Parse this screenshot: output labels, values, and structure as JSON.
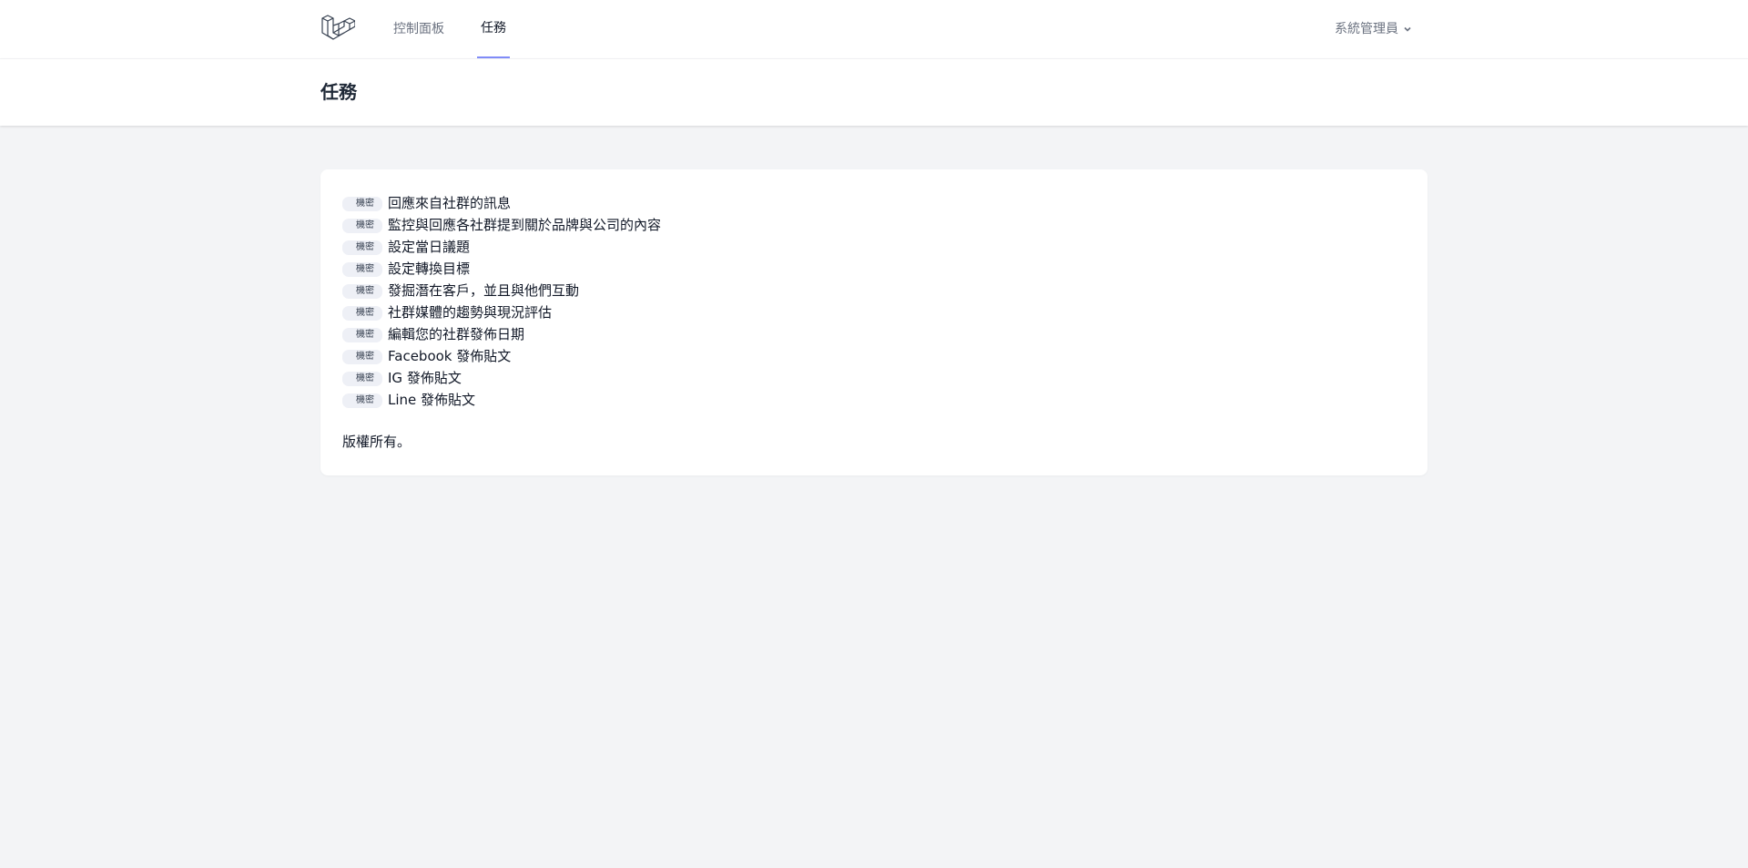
{
  "nav": {
    "links": [
      {
        "label": "控制面板"
      },
      {
        "label": "任務"
      }
    ],
    "user_name": "系統管理員"
  },
  "header": {
    "title": "任務"
  },
  "tasks": [
    {
      "badge": "機密",
      "title": "回應來自社群的訊息"
    },
    {
      "badge": "機密",
      "title": "監控與回應各社群提到關於品牌與公司的內容"
    },
    {
      "badge": "機密",
      "title": "設定當日議題"
    },
    {
      "badge": "機密",
      "title": "設定轉換目標"
    },
    {
      "badge": "機密",
      "title": "發掘潛在客戶，並且與他們互動"
    },
    {
      "badge": "機密",
      "title": "社群媒體的趨勢與現況評估"
    },
    {
      "badge": "機密",
      "title": "編輯您的社群發佈日期"
    },
    {
      "badge": "機密",
      "title": "Facebook 發佈貼文"
    },
    {
      "badge": "機密",
      "title": "IG 發佈貼文"
    },
    {
      "badge": "機密",
      "title": "Line 發佈貼文"
    }
  ],
  "footer": {
    "copyright": "版權所有。"
  },
  "colors": {
    "accent": "#818cf8",
    "background": "#f3f4f6",
    "badge_bg": "#eef0f6"
  }
}
